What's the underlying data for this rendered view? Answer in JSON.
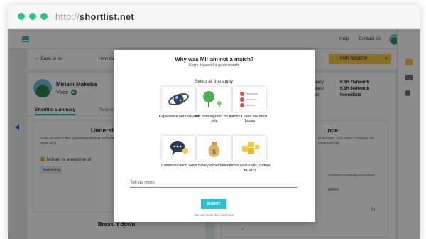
{
  "browser": {
    "url_prefix": "http://",
    "url_domain": "shortlist.net"
  },
  "app": {
    "topbar": {
      "help": "Help",
      "contact": "Contact Us"
    },
    "subbar": {
      "back": "Back to list",
      "question_partial": "How did you",
      "status_button": "FOR REVIEW"
    },
    "candidate": {
      "name": "Miriam Makeba",
      "role": "Voice"
    },
    "tabs": [
      "Shortlist summary",
      "Resume"
    ],
    "left_panel": {
      "title": "Understanding",
      "text": "Skills in which the candidate tested exception more in a",
      "awesome": "Miriam is awesome at",
      "tag": "Marketing"
    },
    "breakdown_title": "Break it down",
    "right_card": {
      "rows": [
        {
          "label": "alary",
          "value": "KSH 75/month"
        },
        {
          "label": "alary",
          "value": "KSH 84/month"
        },
        {
          "label": "ed",
          "value": "Immediate"
        }
      ],
      "panel_title": "nce",
      "panel_text": "to Miriam. The chart changes an assessment.",
      "panel_text2": "xcludes manually reviewed",
      "panel_text3": "pplied.",
      "chart_tick": "10"
    }
  },
  "modal": {
    "title": "Why was Miriam not a match?",
    "subtitle": "Sorry it wasn't a good match.",
    "select_prompt": "Select all that apply:",
    "options": [
      {
        "label": "Experience not relevant",
        "icon": "galaxy-icon"
      },
      {
        "label": "Too senior/junior for the role",
        "icon": "tree-sapling-icon"
      },
      {
        "label": "Didn't have the must haves",
        "icon": "checklist-icon"
      },
      {
        "label": "Communication skills",
        "icon": "speech-bubble-icon"
      },
      {
        "label": "Salary expectations",
        "icon": "money-bag-icon"
      },
      {
        "label": "Other (soft skills, culture fit, etc)",
        "icon": "puzzle-icon"
      }
    ],
    "tell_placeholder": "Tell us more",
    "submit_label": "SUBMIT",
    "footnote": "We will email the candidate."
  },
  "colors": {
    "accent": "#26c1cf",
    "status": "#f6c945",
    "dot": "#2ec27e",
    "link_arrow": "#2b5fa8"
  }
}
